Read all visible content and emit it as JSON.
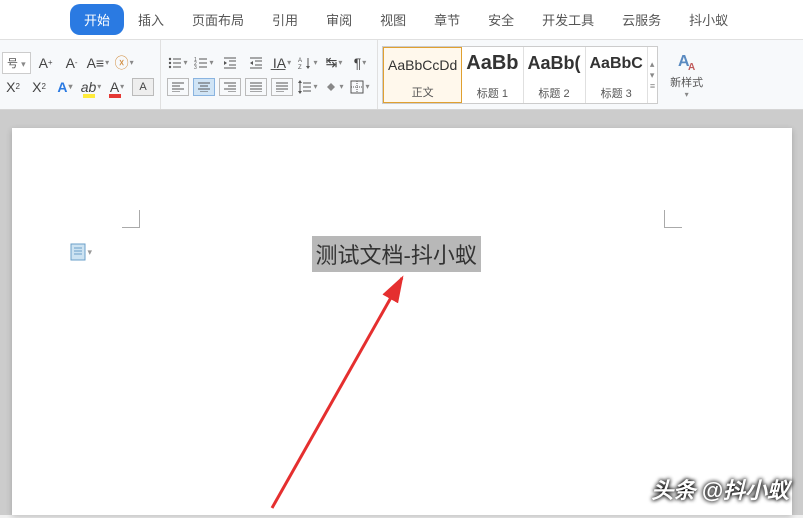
{
  "tabs": {
    "start": "开始",
    "insert": "插入",
    "layout": "页面布局",
    "reference": "引用",
    "review": "审阅",
    "view": "视图",
    "chapter": "章节",
    "security": "安全",
    "devtools": "开发工具",
    "cloud": "云服务",
    "douxiaoyi": "抖小蚁"
  },
  "font": {
    "size_label": "号",
    "inc": "A⁺",
    "dec": "A⁻"
  },
  "styles": {
    "preview": "AaBbCcDd",
    "preview2": "AaBb",
    "preview3": "AaBb(",
    "preview4": "AaBbC",
    "normal": "正文",
    "h1": "标题 1",
    "h2": "标题 2",
    "h3": "标题 3",
    "new_style": "新样式"
  },
  "document": {
    "selected_text": "测试文档-抖小蚁"
  },
  "watermark": "头条 @抖小蚁"
}
